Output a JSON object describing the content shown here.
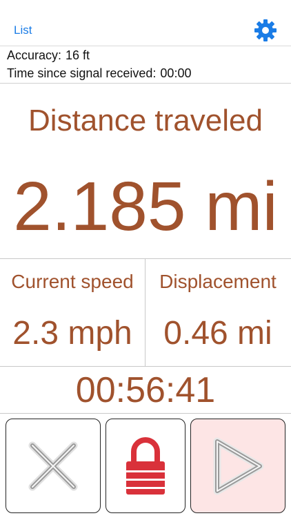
{
  "nav": {
    "list_label": "List"
  },
  "info": {
    "accuracy_label": "Accuracy:",
    "accuracy_value": "16 ft",
    "signal_label": "Time since signal received:",
    "signal_value": "00:00"
  },
  "main": {
    "distance_label": "Distance traveled",
    "distance_value": "2.185 mi",
    "speed_label": "Current speed",
    "speed_value": "2.3 mph",
    "displacement_label": "Displacement",
    "displacement_value": "0.46 mi",
    "elapsed_time": "00:56:41"
  },
  "colors": {
    "accent": "#1a7ce6",
    "metric": "#a0522d",
    "lock": "#d9313a",
    "play_bg": "#fde5e5"
  },
  "icons": [
    "gear-icon",
    "close-icon",
    "lock-icon",
    "play-icon"
  ]
}
